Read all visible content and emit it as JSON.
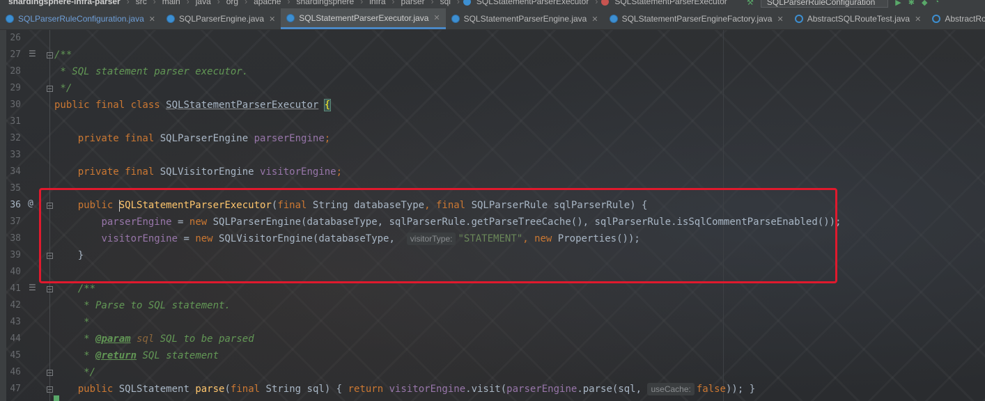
{
  "navbar": {
    "crumbs": [
      "shardingsphere-infra-parser",
      "src",
      "main",
      "java",
      "org",
      "apache",
      "shardingsphere",
      "infra",
      "parser",
      "sql",
      "SQLStatementParserExecutor",
      "SQLStatementParserExecutor"
    ],
    "run_config": "SQLParserRuleConfiguration"
  },
  "tabs": [
    {
      "label": "SQLParserRuleConfiguration.java",
      "active": false,
      "modified": true
    },
    {
      "label": "SQLParserEngine.java",
      "active": false,
      "modified": false
    },
    {
      "label": "SQLStatementParserExecutor.java",
      "active": true,
      "modified": false
    },
    {
      "label": "SQLStatementParserEngine.java",
      "active": false,
      "modified": false
    },
    {
      "label": "SQLStatementParserEngineFactory.java",
      "active": false,
      "modified": false
    },
    {
      "label": "AbstractSQLRouteTest.java",
      "active": false,
      "modified": false
    },
    {
      "label": "AbstractRoutingE",
      "active": false,
      "modified": false
    }
  ],
  "editor": {
    "line_numbers": [
      "26",
      "27",
      "28",
      "29",
      "30",
      "31",
      "32",
      "33",
      "34",
      "35",
      "36",
      "37",
      "38",
      "39",
      "40",
      "41",
      "42",
      "43",
      "44",
      "45",
      "46",
      "47"
    ],
    "current_line": "36",
    "code": {
      "l27": "/**",
      "l28": " * SQL statement parser executor.",
      "l29": " */",
      "l30_kw": "public final class",
      "l30_cls": "SQLStatementParserExecutor",
      "l30_brace": "{",
      "l32_kw": "private final",
      "l32_type": "SQLParserEngine",
      "l32_field": "parserEngine",
      "l34_kw": "private final",
      "l34_type": "SQLVisitorEngine",
      "l34_field": "visitorEngine",
      "l36_kw": "public",
      "l36_ctor": "SQLStatementParserExecutor",
      "l36_p_final1": "final",
      "l36_p_type1": "String",
      "l36_p_name1": "databaseType",
      "l36_p_final2": "final",
      "l36_p_type2": "SQLParserRule",
      "l36_p_name2": "sqlParserRule",
      "l37_field": "parserEngine",
      "l37_new": "new",
      "l37_rest": "SQLParserEngine(databaseType, sqlParserRule.getParseTreeCache(), sqlParserRule.isSqlCommentParseEnabled());",
      "l38_field": "visitorEngine",
      "l38_new": "new",
      "l38_call": "SQLVisitorEngine(databaseType,",
      "l38_hint": "visitorType:",
      "l38_str": "\"STATEMENT\"",
      "l38_new2": "new",
      "l38_tail": "Properties());",
      "l39": "}",
      "l41": "/**",
      "l42": " * Parse to SQL statement.",
      "l43": " *",
      "l44_star": " * ",
      "l44_tag": "@param",
      "l44_arg": "sql",
      "l44_rest": " SQL to be parsed",
      "l45_star": " * ",
      "l45_tag": "@return",
      "l45_rest": " SQL statement",
      "l46": " */",
      "l47_kw": "public",
      "l47_type": "SQLStatement",
      "l47_method": "parse",
      "l47_final": "final",
      "l47_ptype": "String",
      "l47_pname": "sql) {",
      "l47_return": "return",
      "l47_field1": "visitorEngine",
      "l47_visit": ".visit(",
      "l47_field2": "parserEngine",
      "l47_parse": ".parse(sql,",
      "l47_hint": "useCache:",
      "l47_false": "false",
      "l47_end": ")); }"
    }
  },
  "annotation": {
    "color": "#e0192d"
  }
}
